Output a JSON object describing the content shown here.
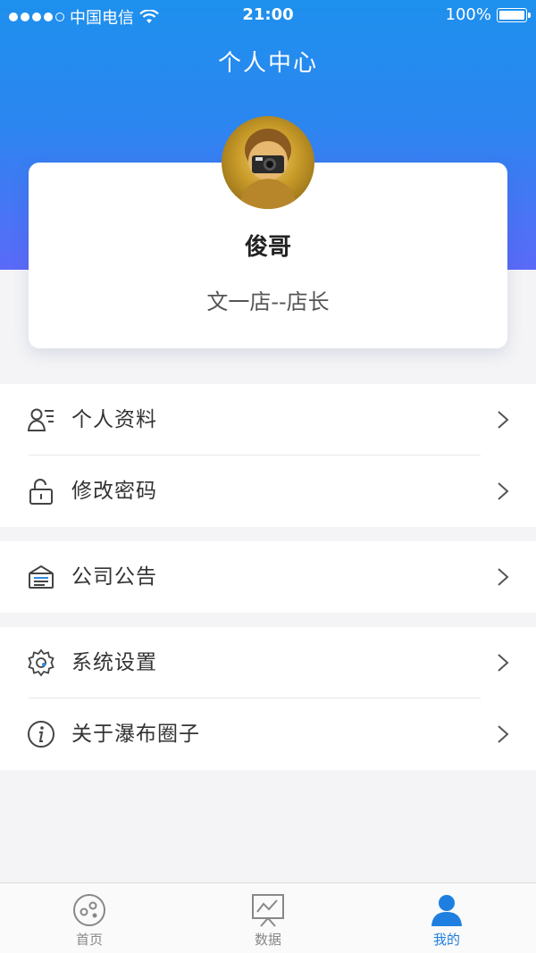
{
  "status_bar": {
    "carrier": "中国电信",
    "time": "21:00",
    "battery": "100%"
  },
  "header": {
    "title": "个人中心"
  },
  "profile": {
    "name": "俊哥",
    "role": "文一店--店长"
  },
  "menu": {
    "group1": [
      {
        "label": "个人资料",
        "icon": "profile-card-icon"
      },
      {
        "label": "修改密码",
        "icon": "unlock-icon"
      }
    ],
    "group2": [
      {
        "label": "公司公告",
        "icon": "announcement-icon"
      }
    ],
    "group3": [
      {
        "label": "系统设置",
        "icon": "gear-icon"
      },
      {
        "label": "关于瀑布圈子",
        "icon": "info-icon"
      }
    ]
  },
  "tab_bar": {
    "tabs": [
      {
        "label": "首页",
        "icon": "home-circle-icon",
        "active": false
      },
      {
        "label": "数据",
        "icon": "chart-board-icon",
        "active": false
      },
      {
        "label": "我的",
        "icon": "person-icon",
        "active": true
      }
    ]
  },
  "colors": {
    "accent": "#1e7fe0",
    "hero_top": "#1e90ee",
    "hero_bottom": "#5a6af8"
  }
}
